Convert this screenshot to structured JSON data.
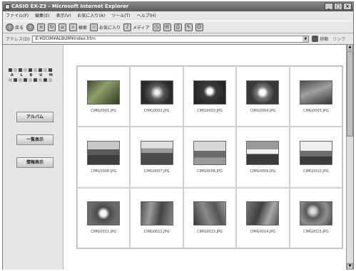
{
  "window": {
    "title": "CASIO EX-Z3 - Microsoft Internet Explorer",
    "controls": [
      "_",
      "□",
      "×"
    ]
  },
  "menubar": [
    "ファイル(F)",
    "編集(E)",
    "表示(V)",
    "お気に入り(A)",
    "ツール(T)",
    "ヘルプ(H)"
  ],
  "toolbar": {
    "back_label": "戻る",
    "search_label": "検索",
    "favorites_label": "お気に入り",
    "media_label": "メディア"
  },
  "addressbar": {
    "label": "アドレス(D)",
    "value": "E:¥DCIM¥ALBUM¥index.htm",
    "go_label": "移動",
    "links_label": "リンク"
  },
  "sidebar": {
    "logo_text": "A L B U M",
    "buttons": [
      {
        "label": "アルバム"
      },
      {
        "label": "一覧表示"
      },
      {
        "label": "情報表示"
      }
    ]
  },
  "album": {
    "photos": [
      {
        "file": "CIMG0001.JPG"
      },
      {
        "file": "CIMG0002.JPG"
      },
      {
        "file": "CIMG0003.JPG"
      },
      {
        "file": "CIMG0004.JPG"
      },
      {
        "file": "CIMG0005.JPG"
      },
      {
        "file": "CIMG0006.JPG"
      },
      {
        "file": "CIMG0007.JPG"
      },
      {
        "file": "CIMG0008.JPG"
      },
      {
        "file": "CIMG0009.JPG"
      },
      {
        "file": "CIMG0010.JPG"
      },
      {
        "file": "CIMG0011.JPG"
      },
      {
        "file": "CIMG0012.JPG"
      },
      {
        "file": "CIMG0013.JPG"
      },
      {
        "file": "CIMG0014.JPG"
      },
      {
        "file": "CIMG0015.JPG"
      }
    ]
  }
}
